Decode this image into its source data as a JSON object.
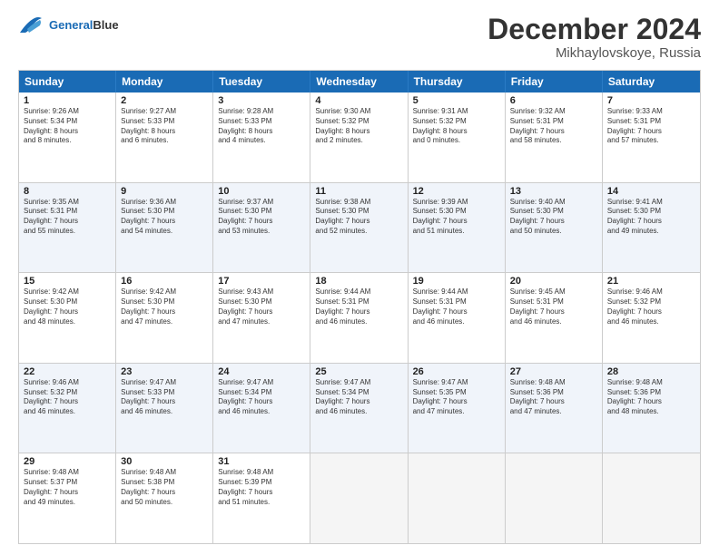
{
  "logo": {
    "text_general": "General",
    "text_blue": "Blue"
  },
  "title": "December 2024",
  "location": "Mikhaylovskoye, Russia",
  "days": [
    "Sunday",
    "Monday",
    "Tuesday",
    "Wednesday",
    "Thursday",
    "Friday",
    "Saturday"
  ],
  "rows": [
    [
      {
        "day": "1",
        "lines": [
          "Sunrise: 9:26 AM",
          "Sunset: 5:34 PM",
          "Daylight: 8 hours",
          "and 8 minutes."
        ]
      },
      {
        "day": "2",
        "lines": [
          "Sunrise: 9:27 AM",
          "Sunset: 5:33 PM",
          "Daylight: 8 hours",
          "and 6 minutes."
        ]
      },
      {
        "day": "3",
        "lines": [
          "Sunrise: 9:28 AM",
          "Sunset: 5:33 PM",
          "Daylight: 8 hours",
          "and 4 minutes."
        ]
      },
      {
        "day": "4",
        "lines": [
          "Sunrise: 9:30 AM",
          "Sunset: 5:32 PM",
          "Daylight: 8 hours",
          "and 2 minutes."
        ]
      },
      {
        "day": "5",
        "lines": [
          "Sunrise: 9:31 AM",
          "Sunset: 5:32 PM",
          "Daylight: 8 hours",
          "and 0 minutes."
        ]
      },
      {
        "day": "6",
        "lines": [
          "Sunrise: 9:32 AM",
          "Sunset: 5:31 PM",
          "Daylight: 7 hours",
          "and 58 minutes."
        ]
      },
      {
        "day": "7",
        "lines": [
          "Sunrise: 9:33 AM",
          "Sunset: 5:31 PM",
          "Daylight: 7 hours",
          "and 57 minutes."
        ]
      }
    ],
    [
      {
        "day": "8",
        "lines": [
          "Sunrise: 9:35 AM",
          "Sunset: 5:31 PM",
          "Daylight: 7 hours",
          "and 55 minutes."
        ]
      },
      {
        "day": "9",
        "lines": [
          "Sunrise: 9:36 AM",
          "Sunset: 5:30 PM",
          "Daylight: 7 hours",
          "and 54 minutes."
        ]
      },
      {
        "day": "10",
        "lines": [
          "Sunrise: 9:37 AM",
          "Sunset: 5:30 PM",
          "Daylight: 7 hours",
          "and 53 minutes."
        ]
      },
      {
        "day": "11",
        "lines": [
          "Sunrise: 9:38 AM",
          "Sunset: 5:30 PM",
          "Daylight: 7 hours",
          "and 52 minutes."
        ]
      },
      {
        "day": "12",
        "lines": [
          "Sunrise: 9:39 AM",
          "Sunset: 5:30 PM",
          "Daylight: 7 hours",
          "and 51 minutes."
        ]
      },
      {
        "day": "13",
        "lines": [
          "Sunrise: 9:40 AM",
          "Sunset: 5:30 PM",
          "Daylight: 7 hours",
          "and 50 minutes."
        ]
      },
      {
        "day": "14",
        "lines": [
          "Sunrise: 9:41 AM",
          "Sunset: 5:30 PM",
          "Daylight: 7 hours",
          "and 49 minutes."
        ]
      }
    ],
    [
      {
        "day": "15",
        "lines": [
          "Sunrise: 9:42 AM",
          "Sunset: 5:30 PM",
          "Daylight: 7 hours",
          "and 48 minutes."
        ]
      },
      {
        "day": "16",
        "lines": [
          "Sunrise: 9:42 AM",
          "Sunset: 5:30 PM",
          "Daylight: 7 hours",
          "and 47 minutes."
        ]
      },
      {
        "day": "17",
        "lines": [
          "Sunrise: 9:43 AM",
          "Sunset: 5:30 PM",
          "Daylight: 7 hours",
          "and 47 minutes."
        ]
      },
      {
        "day": "18",
        "lines": [
          "Sunrise: 9:44 AM",
          "Sunset: 5:31 PM",
          "Daylight: 7 hours",
          "and 46 minutes."
        ]
      },
      {
        "day": "19",
        "lines": [
          "Sunrise: 9:44 AM",
          "Sunset: 5:31 PM",
          "Daylight: 7 hours",
          "and 46 minutes."
        ]
      },
      {
        "day": "20",
        "lines": [
          "Sunrise: 9:45 AM",
          "Sunset: 5:31 PM",
          "Daylight: 7 hours",
          "and 46 minutes."
        ]
      },
      {
        "day": "21",
        "lines": [
          "Sunrise: 9:46 AM",
          "Sunset: 5:32 PM",
          "Daylight: 7 hours",
          "and 46 minutes."
        ]
      }
    ],
    [
      {
        "day": "22",
        "lines": [
          "Sunrise: 9:46 AM",
          "Sunset: 5:32 PM",
          "Daylight: 7 hours",
          "and 46 minutes."
        ]
      },
      {
        "day": "23",
        "lines": [
          "Sunrise: 9:47 AM",
          "Sunset: 5:33 PM",
          "Daylight: 7 hours",
          "and 46 minutes."
        ]
      },
      {
        "day": "24",
        "lines": [
          "Sunrise: 9:47 AM",
          "Sunset: 5:34 PM",
          "Daylight: 7 hours",
          "and 46 minutes."
        ]
      },
      {
        "day": "25",
        "lines": [
          "Sunrise: 9:47 AM",
          "Sunset: 5:34 PM",
          "Daylight: 7 hours",
          "and 46 minutes."
        ]
      },
      {
        "day": "26",
        "lines": [
          "Sunrise: 9:47 AM",
          "Sunset: 5:35 PM",
          "Daylight: 7 hours",
          "and 47 minutes."
        ]
      },
      {
        "day": "27",
        "lines": [
          "Sunrise: 9:48 AM",
          "Sunset: 5:36 PM",
          "Daylight: 7 hours",
          "and 47 minutes."
        ]
      },
      {
        "day": "28",
        "lines": [
          "Sunrise: 9:48 AM",
          "Sunset: 5:36 PM",
          "Daylight: 7 hours",
          "and 48 minutes."
        ]
      }
    ],
    [
      {
        "day": "29",
        "lines": [
          "Sunrise: 9:48 AM",
          "Sunset: 5:37 PM",
          "Daylight: 7 hours",
          "and 49 minutes."
        ]
      },
      {
        "day": "30",
        "lines": [
          "Sunrise: 9:48 AM",
          "Sunset: 5:38 PM",
          "Daylight: 7 hours",
          "and 50 minutes."
        ]
      },
      {
        "day": "31",
        "lines": [
          "Sunrise: 9:48 AM",
          "Sunset: 5:39 PM",
          "Daylight: 7 hours",
          "and 51 minutes."
        ]
      },
      null,
      null,
      null,
      null
    ]
  ]
}
